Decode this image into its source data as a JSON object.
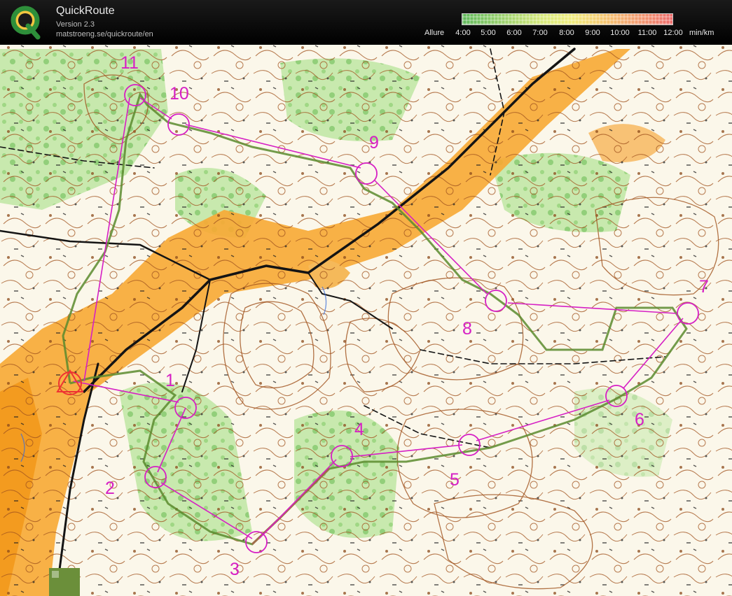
{
  "app": {
    "title": "QuickRoute",
    "version": "Version 2.3",
    "url": "matstroeng.se/quickroute/en"
  },
  "legend": {
    "label": "Allure",
    "ticks": [
      "4:00",
      "5:00",
      "6:00",
      "7:00",
      "8:00",
      "9:00",
      "10:00",
      "11:00",
      "12:00"
    ],
    "unit": "min/km",
    "colors": [
      "#5fb85a",
      "#96cf6b",
      "#d7e97a",
      "#f1ee7d",
      "#f6c56f",
      "#f39a70",
      "#ee6b6b"
    ]
  },
  "map": {
    "course_color": "#d61fc4",
    "route_color": "#6a9a3a",
    "control_labels": [
      "1",
      "2",
      "3",
      "4",
      "5",
      "6",
      "7",
      "8",
      "9",
      "10",
      "11"
    ]
  }
}
